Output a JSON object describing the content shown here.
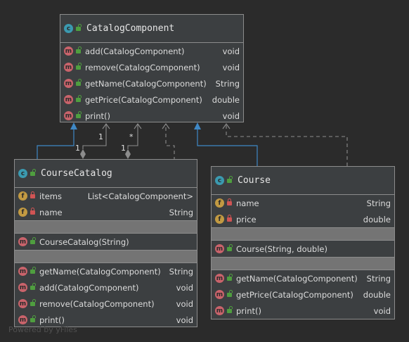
{
  "diagram": {
    "watermark": "Powered by yFiles",
    "classes": {
      "catalog_component": {
        "name": "CatalogComponent",
        "kind_icon": "c",
        "methods": [
          {
            "name": "add(CatalogComponent)",
            "type": "void"
          },
          {
            "name": "remove(CatalogComponent)",
            "type": "void"
          },
          {
            "name": "getName(CatalogComponent)",
            "type": "String"
          },
          {
            "name": "getPrice(CatalogComponent)",
            "type": "double"
          },
          {
            "name": "print()",
            "type": "void"
          }
        ]
      },
      "course_catalog": {
        "name": "CourseCatalog",
        "kind_icon": "c",
        "fields": [
          {
            "name": "items",
            "type": "List<CatalogComponent>"
          },
          {
            "name": "name",
            "type": "String"
          }
        ],
        "constructors": [
          {
            "name": "CourseCatalog(String)",
            "type": ""
          }
        ],
        "methods": [
          {
            "name": "getName(CatalogComponent)",
            "type": "String"
          },
          {
            "name": "add(CatalogComponent)",
            "type": "void"
          },
          {
            "name": "remove(CatalogComponent)",
            "type": "void"
          },
          {
            "name": "print()",
            "type": "void"
          }
        ]
      },
      "course": {
        "name": "Course",
        "kind_icon": "c",
        "fields": [
          {
            "name": "name",
            "type": "String"
          },
          {
            "name": "price",
            "type": "double"
          }
        ],
        "constructors": [
          {
            "name": "Course(String, double)",
            "type": ""
          }
        ],
        "methods": [
          {
            "name": "getName(CatalogComponent)",
            "type": "String"
          },
          {
            "name": "getPrice(CatalogComponent)",
            "type": "double"
          },
          {
            "name": "print()",
            "type": "void"
          }
        ]
      }
    },
    "multiplicities": {
      "items_source": "1",
      "items_target": "*",
      "parent_source": "1",
      "parent_target": "1"
    },
    "colors": {
      "background": "#2b2b2b",
      "box": "#3c3f41",
      "inheritance": "#3f88c5",
      "association": "#8c8c8c",
      "class_badge": "#3b9ab0",
      "method_badge": "#c9636b",
      "field_badge": "#c29a42"
    }
  }
}
